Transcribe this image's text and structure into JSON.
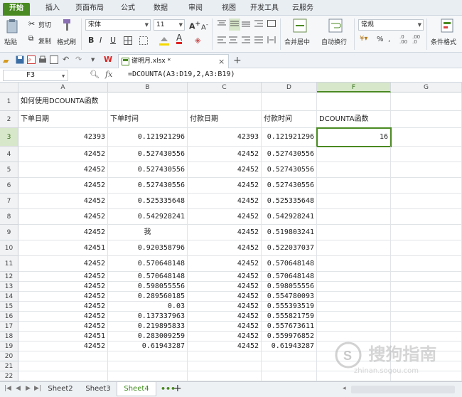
{
  "ribbon_tabs": [
    "开始",
    "插入",
    "页面布局",
    "公式",
    "数据",
    "审阅",
    "视图",
    "开发工具",
    "云服务"
  ],
  "ribbon": {
    "paste": "粘贴",
    "cut": "剪切",
    "copy": "复制",
    "format_painter": "格式刷",
    "font_name": "宋体",
    "font_size": "11",
    "merge_center": "合并居中",
    "wrap_text": "自动换行",
    "number_format": "常规",
    "conditional_format": "条件格式"
  },
  "doc_tab": "谢明月.xlsx *",
  "formula_bar": {
    "name_box": "F3",
    "fx": "fx",
    "formula": "=DCOUNTA(A3:D19,2,A3:B19)"
  },
  "columns": [
    "A",
    "B",
    "C",
    "D",
    "F",
    "G"
  ],
  "active_column": "F",
  "rows": [
    {
      "n": "1",
      "a": "如何使用DCOUNTA函数",
      "b": "",
      "c": "",
      "d": "",
      "f": ""
    },
    {
      "n": "2",
      "a": "下单日期",
      "b": "下单时间",
      "c": "付款日期",
      "d": "付款时间",
      "f": "DCOUNTA函数"
    },
    {
      "n": "3",
      "a": "42393",
      "b": "0.121921296",
      "c": "42393",
      "d": "0.121921296",
      "f": "16"
    },
    {
      "n": "4",
      "a": "42452",
      "b": "0.527430556",
      "c": "42452",
      "d": "0.527430556",
      "f": ""
    },
    {
      "n": "5",
      "a": "42452",
      "b": "0.527430556",
      "c": "42452",
      "d": "0.527430556",
      "f": ""
    },
    {
      "n": "6",
      "a": "42452",
      "b": "0.527430556",
      "c": "42452",
      "d": "0.527430556",
      "f": ""
    },
    {
      "n": "7",
      "a": "42452",
      "b": "0.525335648",
      "c": "42452",
      "d": "0.525335648",
      "f": ""
    },
    {
      "n": "8",
      "a": "42452",
      "b": "0.542928241",
      "c": "42452",
      "d": "0.542928241",
      "f": ""
    },
    {
      "n": "9",
      "a": "42452",
      "b": "我",
      "c": "42452",
      "d": "0.519803241",
      "f": ""
    },
    {
      "n": "10",
      "a": "42451",
      "b": "0.920358796",
      "c": "42452",
      "d": "0.522037037",
      "f": ""
    },
    {
      "n": "11",
      "a": "42452",
      "b": "0.570648148",
      "c": "42452",
      "d": "0.570648148",
      "f": ""
    },
    {
      "n": "12",
      "a": "42452",
      "b": "0.570648148",
      "c": "42452",
      "d": "0.570648148",
      "f": ""
    },
    {
      "n": "13",
      "a": "42452",
      "b": "0.598055556",
      "c": "42452",
      "d": "0.598055556",
      "f": ""
    },
    {
      "n": "14",
      "a": "42452",
      "b": "0.289560185",
      "c": "42452",
      "d": "0.554780093",
      "f": ""
    },
    {
      "n": "15",
      "a": "42452",
      "b": "0.03",
      "c": "42452",
      "d": "0.555393519",
      "f": ""
    },
    {
      "n": "16",
      "a": "42452",
      "b": "0.137337963",
      "c": "42452",
      "d": "0.555821759",
      "f": ""
    },
    {
      "n": "17",
      "a": "42452",
      "b": "0.219895833",
      "c": "42452",
      "d": "0.557673611",
      "f": ""
    },
    {
      "n": "18",
      "a": "42451",
      "b": "0.283009259",
      "c": "42452",
      "d": "0.559976852",
      "f": ""
    },
    {
      "n": "19",
      "a": "42452",
      "b": "0.61943287",
      "c": "42452",
      "d": "0.61943287",
      "f": ""
    },
    {
      "n": "20",
      "a": "",
      "b": "",
      "c": "",
      "d": "",
      "f": ""
    },
    {
      "n": "21",
      "a": "",
      "b": "",
      "c": "",
      "d": "",
      "f": ""
    },
    {
      "n": "22",
      "a": "",
      "b": "",
      "c": "",
      "d": "",
      "f": ""
    }
  ],
  "sheet_tabs": [
    "Sheet2",
    "Sheet3",
    "Sheet4"
  ],
  "active_sheet": "Sheet4",
  "watermark": "搜狗指南",
  "watermark_url": "zhinan.sogou.com",
  "colors": {
    "accent": "#4a8a22",
    "active_tab_text": "#3c8a1a"
  }
}
